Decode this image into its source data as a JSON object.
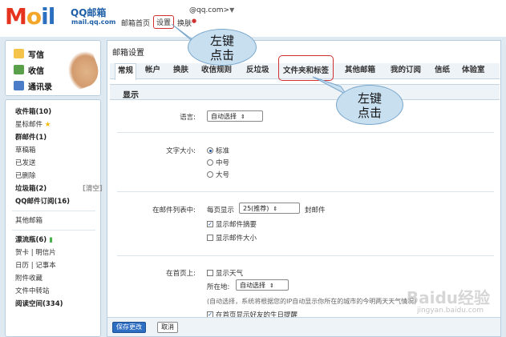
{
  "brand": {
    "logo_text": "Moil",
    "name": "QQ邮箱",
    "domain": "mail.qq.com"
  },
  "account": {
    "email": "@qq.com>",
    "caret": "▼"
  },
  "top_links": {
    "home": "邮箱首页",
    "settings": "设置",
    "skin": "换肤"
  },
  "quick_actions": {
    "compose": "写信",
    "inbox": "收信",
    "contacts": "通讯录"
  },
  "folders": {
    "inbox": "收件箱(10)",
    "starred": "星标邮件",
    "group": "群邮件(1)",
    "drafts": "草稿箱",
    "sent": "已发送",
    "deleted": "已删除",
    "spam": "垃圾箱(2)",
    "spam_clear": "[清空]",
    "subscriptions": "QQ邮件订阅(16)",
    "other": "其他邮箱",
    "drift": "漂流瓶(6)",
    "card": "贺卡",
    "postcard": "明信片",
    "calendar": "日历",
    "notebook": "记事本",
    "attachments": "附件收藏",
    "transfer": "文件中转站",
    "reading": "阅读空间(334)",
    "pipe": "|"
  },
  "main": {
    "title": "邮箱设置",
    "tabs": [
      "常规",
      "帐户",
      "换肤",
      "收信规则",
      "反垃圾",
      "文件夹和标签",
      "其他邮箱",
      "我的订阅",
      "信纸",
      "体验室"
    ],
    "section": "显示"
  },
  "settings": {
    "language_label": "语言:",
    "language_value": "自动选择",
    "font_size_label": "文字大小:",
    "font_options": [
      "标准",
      "中号",
      "大号"
    ],
    "list_label": "在邮件列表中:",
    "per_page_prefix": "每页显示",
    "per_page_value": "25(推荐)",
    "per_page_suffix": "封邮件",
    "show_summary": "显示邮件摘要",
    "show_size": "显示邮件大小",
    "home_label": "在首页上:",
    "show_weather": "显示天气",
    "location_label": "所在地:",
    "location_value": "自动选择",
    "weather_hint": "(自动选择，系统将根据您的IP自动显示你所在的城市的今明两天天气情况)",
    "birthday": "在首页显示好友的生日提醒"
  },
  "buttons": {
    "save": "保存更改",
    "cancel": "取消"
  },
  "annotations": {
    "bubble_1": "左键\n点击",
    "bubble_2": "左键\n点击"
  },
  "watermark": {
    "main": "Baidu经验",
    "sub": "jingyan.baidu.com"
  }
}
